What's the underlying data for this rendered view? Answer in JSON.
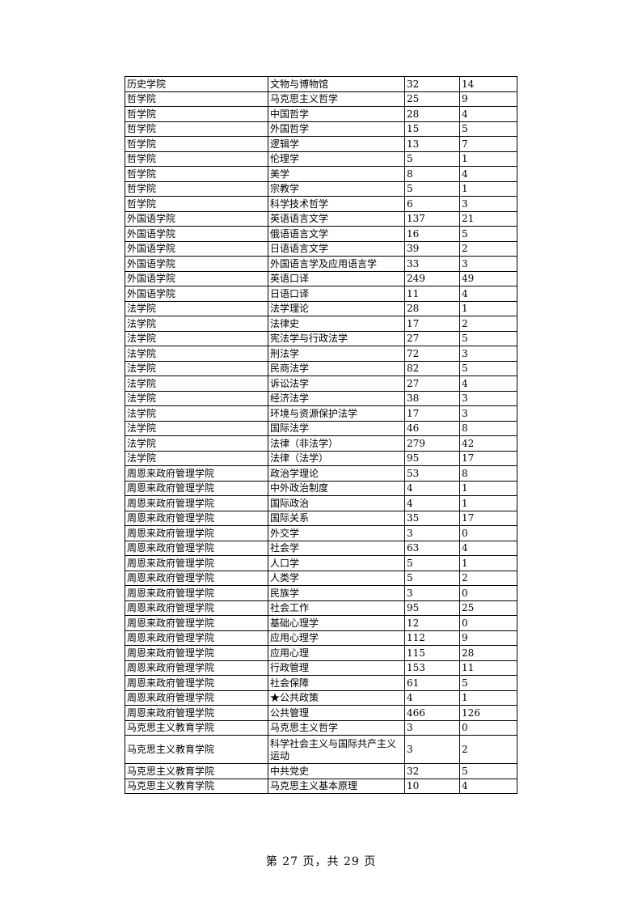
{
  "table": {
    "rows": [
      [
        "历史学院",
        "文物与博物馆",
        "32",
        "14"
      ],
      [
        "哲学院",
        "马克思主义哲学",
        "25",
        "9"
      ],
      [
        "哲学院",
        "中国哲学",
        "28",
        "4"
      ],
      [
        "哲学院",
        "外国哲学",
        "15",
        "5"
      ],
      [
        "哲学院",
        "逻辑学",
        "13",
        "7"
      ],
      [
        "哲学院",
        "伦理学",
        "5",
        "1"
      ],
      [
        "哲学院",
        "美学",
        "8",
        "4"
      ],
      [
        "哲学院",
        "宗教学",
        "5",
        "1"
      ],
      [
        "哲学院",
        "科学技术哲学",
        "6",
        "3"
      ],
      [
        "外国语学院",
        "英语语言文学",
        "137",
        "21"
      ],
      [
        "外国语学院",
        "俄语语言文学",
        "16",
        "5"
      ],
      [
        "外国语学院",
        "日语语言文学",
        "39",
        "2"
      ],
      [
        "外国语学院",
        "外国语言学及应用语言学",
        "33",
        "3"
      ],
      [
        "外国语学院",
        "英语口译",
        "249",
        "49"
      ],
      [
        "外国语学院",
        "日语口译",
        "11",
        "4"
      ],
      [
        "法学院",
        "法学理论",
        "28",
        "1"
      ],
      [
        "法学院",
        "法律史",
        "17",
        "2"
      ],
      [
        "法学院",
        "宪法学与行政法学",
        "27",
        "5"
      ],
      [
        "法学院",
        "刑法学",
        "72",
        "3"
      ],
      [
        "法学院",
        "民商法学",
        "82",
        "5"
      ],
      [
        "法学院",
        "诉讼法学",
        "27",
        "4"
      ],
      [
        "法学院",
        "经济法学",
        "38",
        "3"
      ],
      [
        "法学院",
        "环境与资源保护法学",
        "17",
        "3"
      ],
      [
        "法学院",
        "国际法学",
        "46",
        "8"
      ],
      [
        "法学院",
        "法律（非法学）",
        "279",
        "42"
      ],
      [
        "法学院",
        "法律（法学）",
        "95",
        "17"
      ],
      [
        "周恩来政府管理学院",
        "政治学理论",
        "53",
        "8"
      ],
      [
        "周恩来政府管理学院",
        "中外政治制度",
        "4",
        "1"
      ],
      [
        "周恩来政府管理学院",
        "国际政治",
        "4",
        "1"
      ],
      [
        "周恩来政府管理学院",
        "国际关系",
        "35",
        "17"
      ],
      [
        "周恩来政府管理学院",
        "外交学",
        "3",
        "0"
      ],
      [
        "周恩来政府管理学院",
        "社会学",
        "63",
        "4"
      ],
      [
        "周恩来政府管理学院",
        "人口学",
        "5",
        "1"
      ],
      [
        "周恩来政府管理学院",
        "人类学",
        "5",
        "2"
      ],
      [
        "周恩来政府管理学院",
        "民族学",
        "3",
        "0"
      ],
      [
        "周恩来政府管理学院",
        "社会工作",
        "95",
        "25"
      ],
      [
        "周恩来政府管理学院",
        "基础心理学",
        "12",
        "0"
      ],
      [
        "周恩来政府管理学院",
        "应用心理学",
        "112",
        "9"
      ],
      [
        "周恩来政府管理学院",
        "应用心理",
        "115",
        "28"
      ],
      [
        "周恩来政府管理学院",
        "行政管理",
        "153",
        "11"
      ],
      [
        "周恩来政府管理学院",
        "社会保障",
        "61",
        "5"
      ],
      [
        "周恩来政府管理学院",
        "★公共政策",
        "4",
        "1"
      ],
      [
        "周恩来政府管理学院",
        "公共管理",
        "466",
        "126"
      ],
      [
        "马克思主义教育学院",
        "马克思主义哲学",
        "3",
        "0"
      ],
      [
        "马克思主义教育学院",
        "科学社会主义与国际共产主义运动",
        "3",
        "2"
      ],
      [
        "马克思主义教育学院",
        "中共党史",
        "32",
        "5"
      ],
      [
        "马克思主义教育学院",
        "马克思主义基本原理",
        "10",
        "4"
      ]
    ]
  },
  "footer": {
    "page_label": "第 27 页，共 29 页"
  }
}
